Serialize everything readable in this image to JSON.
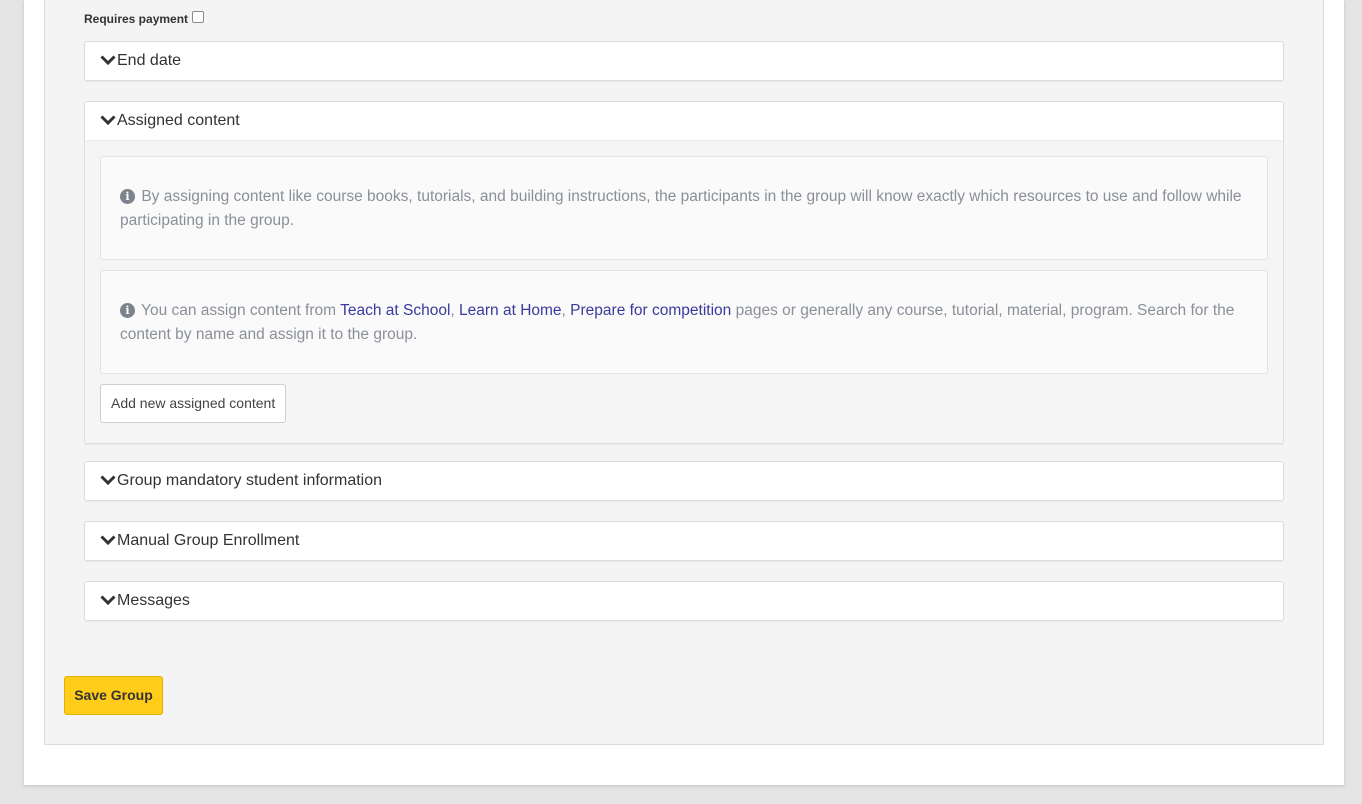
{
  "payment": {
    "label": "Requires payment",
    "checked": false
  },
  "sections": {
    "end_date": {
      "title": "End date"
    },
    "assigned_content": {
      "title": "Assigned content",
      "info1": "By assigning content like course books, tutorials, and building instructions, the participants in the group will know exactly which resources to use and follow while participating in the group.",
      "info2_prefix": "You can assign content from ",
      "link_teach": "Teach at School",
      "sep1": ", ",
      "link_learn": "Learn at Home",
      "sep2": ", ",
      "link_prepare": "Prepare for competition",
      "info2_suffix": " pages or generally any course, tutorial, material, program. Search for the content by name and assign it to the group.",
      "add_button": "Add new assigned content"
    },
    "mandatory_info": {
      "title": "Group mandatory student information"
    },
    "manual_enrollment": {
      "title": "Manual Group Enrollment"
    },
    "messages": {
      "title": "Messages"
    }
  },
  "save_button": "Save Group",
  "icons": {
    "chevron": "chevron-down-icon",
    "info": "info-circle-icon"
  },
  "colors": {
    "accent_button": "#ffcc1a",
    "link": "#3a3a9c"
  }
}
